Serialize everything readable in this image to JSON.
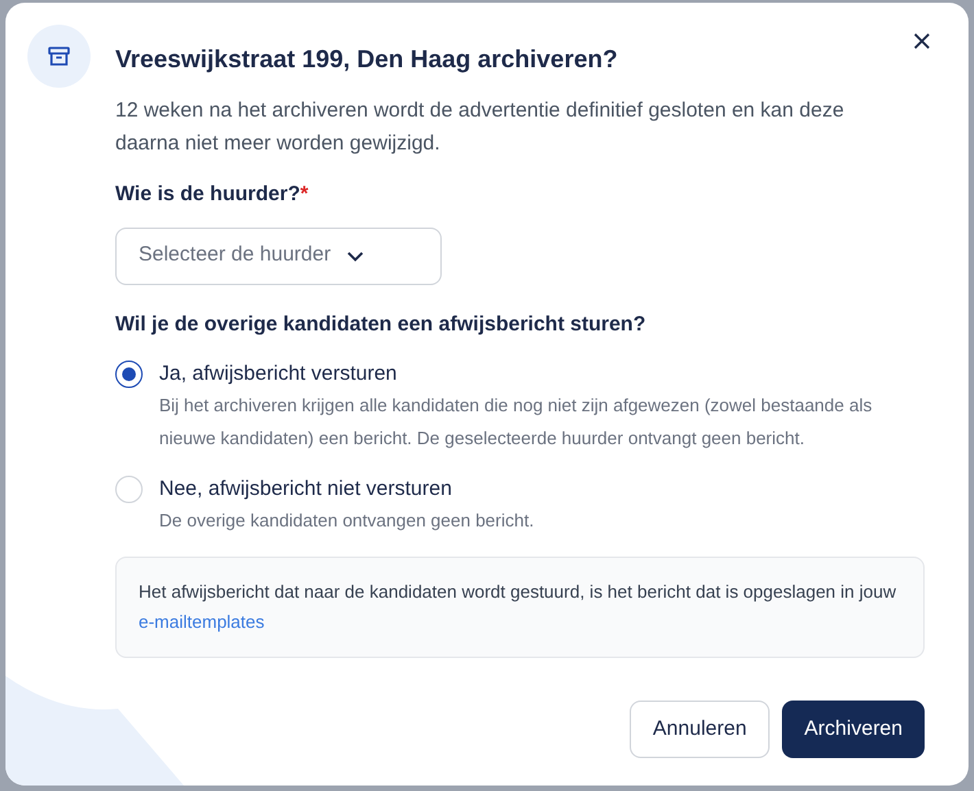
{
  "dialog": {
    "title": "Vreeswijkstraat 199, Den Haag archiveren?",
    "description": "12 weken na het archiveren wordt de advertentie definitief gesloten en kan deze daarna niet meer worden gewijzigd."
  },
  "tenant_field": {
    "label": "Wie is de huurder?",
    "required": true,
    "required_mark": "*",
    "placeholder": "Selecteer de huurder"
  },
  "rejection_question": "Wil je de overige kandidaten een afwijsbericht sturen?",
  "options": [
    {
      "label": "Ja, afwijsbericht versturen",
      "description": "Bij het archiveren krijgen alle kandidaten die nog niet zijn afgewezen (zowel bestaande als nieuwe kandidaten) een bericht. De geselecteerde huurder ontvangt geen bericht.",
      "selected": true
    },
    {
      "label": "Nee, afwijsbericht niet versturen",
      "description": "De overige kandidaten ontvangen geen bericht.",
      "selected": false
    }
  ],
  "info": {
    "text": "Het afwijsbericht dat naar de kandidaten wordt gestuurd, is het bericht dat is opgeslagen in jouw",
    "link": "e-mailtemplates"
  },
  "buttons": [
    {
      "label": "Annuleren",
      "kind": "secondary"
    },
    {
      "label": "Archiveren",
      "kind": "primary"
    }
  ]
}
